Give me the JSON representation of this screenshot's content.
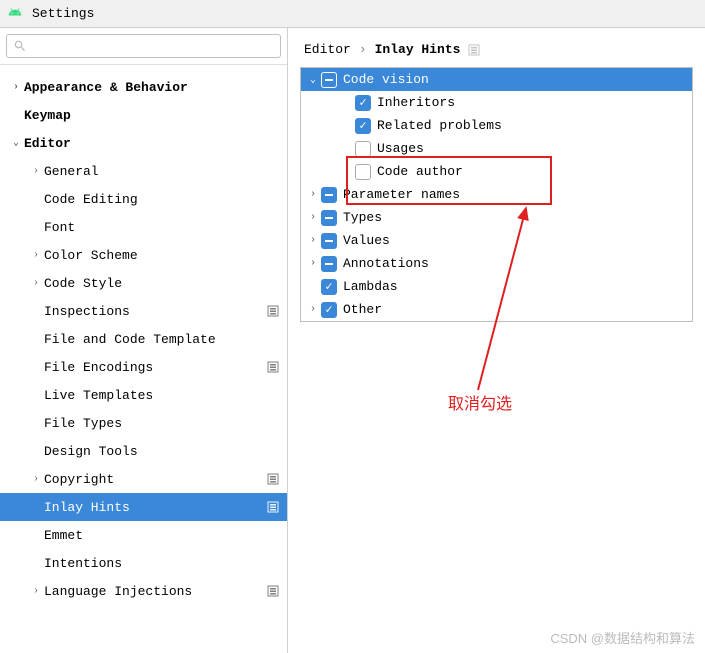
{
  "title": "Settings",
  "breadcrumb": {
    "part1": "Editor",
    "sep": "›",
    "part2": "Inlay Hints"
  },
  "sidebar": [
    {
      "label": "Appearance & Behavior",
      "depth": 0,
      "arrow": "›",
      "bold": true,
      "opts": false
    },
    {
      "label": "Keymap",
      "depth": 0,
      "arrow": "",
      "bold": true,
      "opts": false
    },
    {
      "label": "Editor",
      "depth": 0,
      "arrow": "⌄",
      "bold": true,
      "opts": false
    },
    {
      "label": "General",
      "depth": 1,
      "arrow": "›",
      "bold": false,
      "opts": false
    },
    {
      "label": "Code Editing",
      "depth": 1,
      "arrow": "",
      "bold": false,
      "opts": false
    },
    {
      "label": "Font",
      "depth": 1,
      "arrow": "",
      "bold": false,
      "opts": false
    },
    {
      "label": "Color Scheme",
      "depth": 1,
      "arrow": "›",
      "bold": false,
      "opts": false
    },
    {
      "label": "Code Style",
      "depth": 1,
      "arrow": "›",
      "bold": false,
      "opts": false
    },
    {
      "label": "Inspections",
      "depth": 1,
      "arrow": "",
      "bold": false,
      "opts": true
    },
    {
      "label": "File and Code Template",
      "depth": 1,
      "arrow": "",
      "bold": false,
      "opts": false
    },
    {
      "label": "File Encodings",
      "depth": 1,
      "arrow": "",
      "bold": false,
      "opts": true
    },
    {
      "label": "Live Templates",
      "depth": 1,
      "arrow": "",
      "bold": false,
      "opts": false
    },
    {
      "label": "File Types",
      "depth": 1,
      "arrow": "",
      "bold": false,
      "opts": false
    },
    {
      "label": "Design Tools",
      "depth": 1,
      "arrow": "",
      "bold": false,
      "opts": false
    },
    {
      "label": "Copyright",
      "depth": 1,
      "arrow": "›",
      "bold": false,
      "opts": true
    },
    {
      "label": "Inlay Hints",
      "depth": 1,
      "arrow": "",
      "bold": false,
      "opts": true,
      "selected": true
    },
    {
      "label": "Emmet",
      "depth": 1,
      "arrow": "",
      "bold": false,
      "opts": false
    },
    {
      "label": "Intentions",
      "depth": 1,
      "arrow": "",
      "bold": false,
      "opts": false
    },
    {
      "label": "Language Injections",
      "depth": 1,
      "arrow": "›",
      "bold": false,
      "opts": true
    }
  ],
  "options": [
    {
      "label": "Code vision",
      "arrow": "⌄",
      "state": "partial",
      "depth": 0,
      "selected": true
    },
    {
      "label": "Inheritors",
      "arrow": "",
      "state": "checked",
      "depth": 1
    },
    {
      "label": "Related problems",
      "arrow": "",
      "state": "checked",
      "depth": 1
    },
    {
      "label": "Usages",
      "arrow": "",
      "state": "unchecked",
      "depth": 1
    },
    {
      "label": "Code author",
      "arrow": "",
      "state": "unchecked",
      "depth": 1
    },
    {
      "label": "Parameter names",
      "arrow": "›",
      "state": "partial",
      "depth": 0
    },
    {
      "label": "Types",
      "arrow": "›",
      "state": "partial",
      "depth": 0
    },
    {
      "label": "Values",
      "arrow": "›",
      "state": "partial",
      "depth": 0
    },
    {
      "label": "Annotations",
      "arrow": "›",
      "state": "partial",
      "depth": 0
    },
    {
      "label": "Lambdas",
      "arrow": "",
      "state": "checked",
      "depth": 0
    },
    {
      "label": "Other",
      "arrow": "›",
      "state": "checked",
      "depth": 0
    }
  ],
  "annotation": "取消勾选",
  "watermark": "CSDN @数据结构和算法"
}
